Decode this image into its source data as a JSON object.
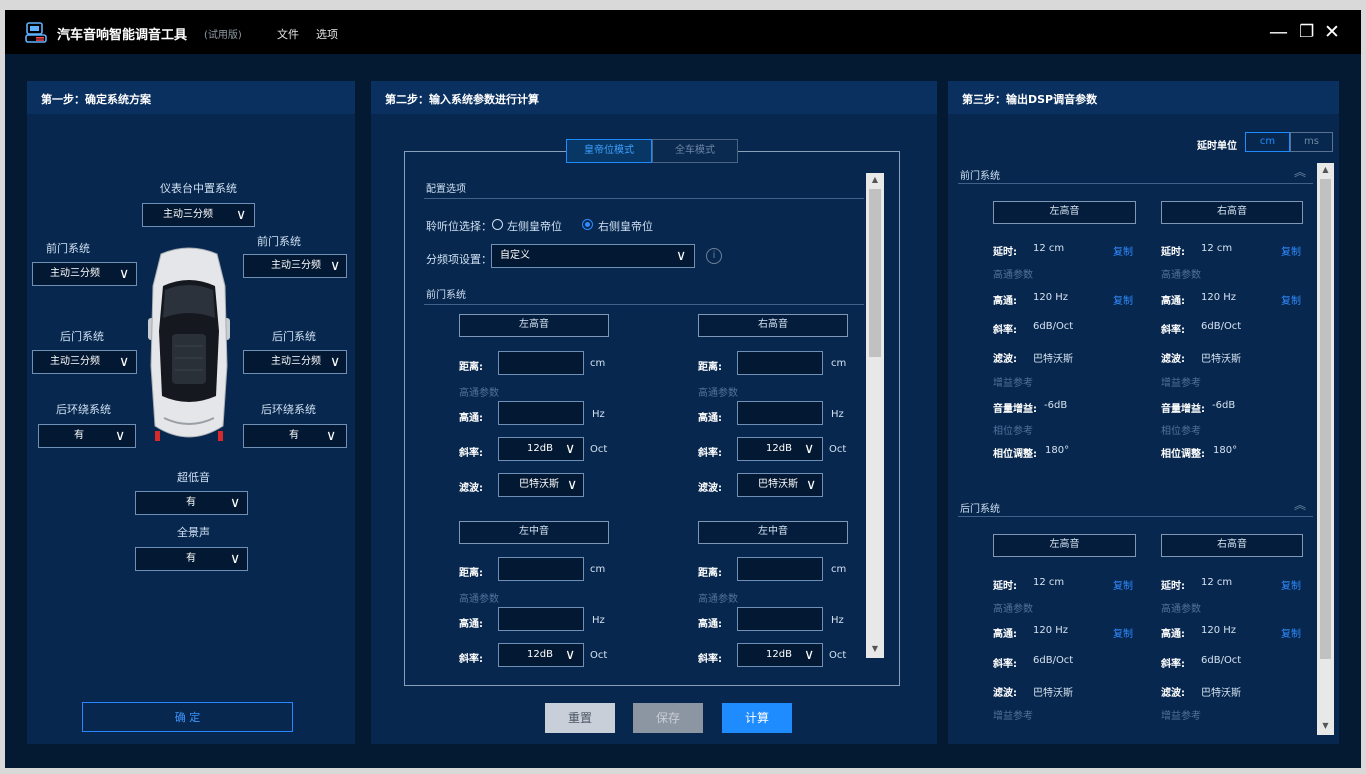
{
  "app": {
    "title": "汽车音响智能调音工具",
    "trial": "(试用版)",
    "menu": [
      "文件",
      "选项"
    ]
  },
  "window_controls": {
    "minimize": "—",
    "maximize": "❐",
    "close": "✕"
  },
  "step1": {
    "title": "第一步：确定系统方案",
    "dashboard": {
      "label": "仪表台中置系统",
      "value": "主动三分频"
    },
    "front_left": {
      "label": "前门系统",
      "value": "主动三分频"
    },
    "front_right": {
      "label": "前门系统",
      "value": "主动三分频"
    },
    "rear_left": {
      "label": "后门系统",
      "value": "主动三分频"
    },
    "rear_right": {
      "label": "后门系统",
      "value": "主动三分频"
    },
    "surround_left": {
      "label": "后环绕系统",
      "value": "有"
    },
    "surround_right": {
      "label": "后环绕系统",
      "value": "有"
    },
    "subwoofer": {
      "label": "超低音",
      "value": "有"
    },
    "fullscene": {
      "label": "全景声",
      "value": "有"
    },
    "confirm": "确 定"
  },
  "step2": {
    "title": "第二步：输入系统参数进行计算",
    "tabs": [
      "皇帝位模式",
      "全车模式"
    ],
    "config_title": "配置选项",
    "seat_label": "聆听位选择：",
    "seat_options": [
      "左侧皇帝位",
      "右侧皇帝位"
    ],
    "crossover_label": "分频项设置：",
    "crossover_value": "自定义",
    "front_title": "前门系统",
    "columns": [
      {
        "name": "左高音",
        "distance_label": "距离:",
        "distance_unit": "cm",
        "hp_caption": "高通参数",
        "hp_label": "高通:",
        "hp_unit": "Hz",
        "slope_label": "斜率:",
        "slope_value": "12dB",
        "slope_unit": "Oct",
        "filter_label": "滤波:",
        "filter_value": "巴特沃斯"
      },
      {
        "name": "右高音",
        "distance_label": "距离:",
        "distance_unit": "cm",
        "hp_caption": "高通参数",
        "hp_label": "高通:",
        "hp_unit": "Hz",
        "slope_label": "斜率:",
        "slope_value": "12dB",
        "slope_unit": "Oct",
        "filter_label": "滤波:",
        "filter_value": "巴特沃斯"
      }
    ],
    "columns2": [
      {
        "name": "左中音",
        "distance_label": "距离:",
        "distance_unit": "cm",
        "hp_caption": "高通参数",
        "hp_label": "高通:",
        "hp_unit": "Hz",
        "slope_label": "斜率:",
        "slope_value": "12dB",
        "slope_unit": "Oct"
      },
      {
        "name": "左中音",
        "distance_label": "距离:",
        "distance_unit": "cm",
        "hp_caption": "高通参数",
        "hp_label": "高通:",
        "hp_unit": "Hz",
        "slope_label": "斜率:",
        "slope_value": "12dB",
        "slope_unit": "Oct"
      }
    ],
    "buttons": {
      "reset": "重置",
      "save": "保存",
      "calc": "计算"
    }
  },
  "step3": {
    "title": "第三步：输出DSP调音参数",
    "delay_unit_label": "延时单位",
    "units": [
      "cm",
      "ms"
    ],
    "front": {
      "title": "前门系统",
      "cols": [
        {
          "name": "左高音",
          "delay_label": "延时:",
          "delay": "12 cm",
          "copy": "复制",
          "hp_caption": "高通参数",
          "hp_label": "高通:",
          "hp": "120 Hz",
          "slope_label": "斜率:",
          "slope": "6dB/Oct",
          "filter_label": "滤波:",
          "filter": "巴特沃斯",
          "gain_caption": "增益参考",
          "gain_label": "音量增益:",
          "gain": "-6dB",
          "phase_caption": "相位参考",
          "phase_label": "相位调整:",
          "phase": "180°"
        },
        {
          "name": "右高音",
          "delay_label": "延时:",
          "delay": "12 cm",
          "copy": "复制",
          "hp_caption": "高通参数",
          "hp_label": "高通:",
          "hp": "120 Hz",
          "slope_label": "斜率:",
          "slope": "6dB/Oct",
          "filter_label": "滤波:",
          "filter": "巴特沃斯",
          "gain_caption": "增益参考",
          "gain_label": "音量增益:",
          "gain": "-6dB",
          "phase_caption": "相位参考",
          "phase_label": "相位调整:",
          "phase": "180°"
        }
      ]
    },
    "rear": {
      "title": "后门系统",
      "cols": [
        {
          "name": "左高音",
          "delay_label": "延时:",
          "delay": "12 cm",
          "copy": "复制",
          "hp_caption": "高通参数",
          "hp_label": "高通:",
          "hp": "120 Hz",
          "slope_label": "斜率:",
          "slope": "6dB/Oct",
          "filter_label": "滤波:",
          "filter": "巴特沃斯",
          "gain_caption": "增益参考"
        },
        {
          "name": "右高音",
          "delay_label": "延时:",
          "delay": "12 cm",
          "copy": "复制",
          "hp_caption": "高通参数",
          "hp_label": "高通:",
          "hp": "120 Hz",
          "slope_label": "斜率:",
          "slope": "6dB/Oct",
          "filter_label": "滤波:",
          "filter": "巴特沃斯",
          "gain_caption": "增益参考"
        }
      ]
    }
  },
  "colors": {
    "accent": "#1e8cff",
    "panel": "#07274e",
    "background": "#041a33"
  }
}
